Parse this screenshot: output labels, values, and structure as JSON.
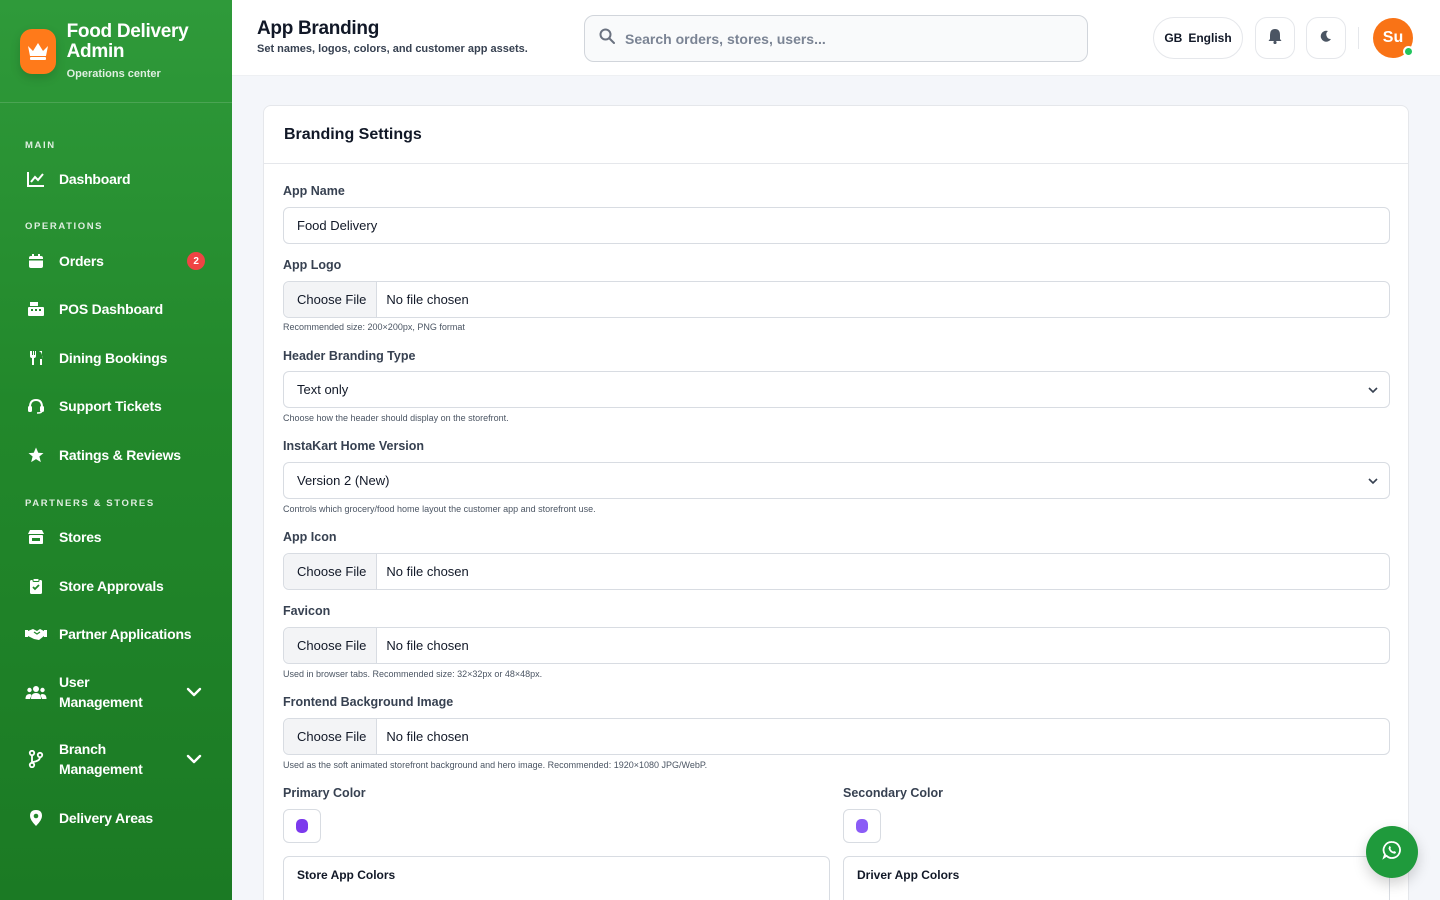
{
  "brand": {
    "title": "Food Delivery Admin",
    "subtitle": "Operations center",
    "logo_icon": "crown-icon"
  },
  "sidebar": {
    "sections": {
      "main": "MAIN",
      "operations": "OPERATIONS",
      "partners": "PARTNERS & STORES"
    },
    "items": [
      {
        "label": "Dashboard",
        "icon": "chart-line-icon"
      },
      {
        "label": "Orders",
        "icon": "calendar-icon",
        "badge": "2"
      },
      {
        "label": "POS Dashboard",
        "icon": "cash-register-icon"
      },
      {
        "label": "Dining Bookings",
        "icon": "utensils-icon"
      },
      {
        "label": "Support Tickets",
        "icon": "headset-icon"
      },
      {
        "label": "Ratings & Reviews",
        "icon": "star-icon"
      },
      {
        "label": "Stores",
        "icon": "store-icon"
      },
      {
        "label": "Store Approvals",
        "icon": "clipboard-check-icon"
      },
      {
        "label": "Partner Applications",
        "icon": "handshake-icon"
      },
      {
        "label_line1": "User",
        "label_line2": "Management",
        "icon": "users-icon"
      },
      {
        "label_line1": "Branch",
        "label_line2": "Management",
        "icon": "branch-icon"
      },
      {
        "label": "Delivery Areas",
        "icon": "map-pin-icon"
      }
    ]
  },
  "header": {
    "title": "App Branding",
    "subtitle": "Set names, logos, colors, and customer app assets.",
    "search_placeholder": "Search orders, stores, users...",
    "language_code": "GB",
    "language": "English",
    "avatar_initials": "Su"
  },
  "form": {
    "card_title": "Branding Settings",
    "app_name_label": "App Name",
    "app_name_value": "Food Delivery",
    "app_logo_label": "App Logo",
    "choose_file": "Choose File",
    "no_file": "No file chosen",
    "app_logo_help": "Recommended size: 200×200px, PNG format",
    "header_type_label": "Header Branding Type",
    "header_type_value": "Text only",
    "header_type_help": "Choose how the header should display on the storefront.",
    "home_version_label": "InstaKart Home Version",
    "home_version_value": "Version 2 (New)",
    "home_version_help": "Controls which grocery/food home layout the customer app and storefront use.",
    "app_icon_label": "App Icon",
    "favicon_label": "Favicon",
    "favicon_help": "Used in browser tabs. Recommended size: 32×32px or 48×48px.",
    "bg_image_label": "Frontend Background Image",
    "bg_image_help": "Used as the soft animated storefront background and hero image. Recommended: 1920×1080 JPG/WebP.",
    "primary_color_label": "Primary Color",
    "primary_color": "#7c3aed",
    "secondary_color_label": "Secondary Color",
    "secondary_color": "#8b5cf6",
    "store_app_colors": "Store App Colors",
    "driver_app_colors": "Driver App Colors"
  },
  "colors": {
    "sidebar": "#22882b",
    "accent": "#ff7a1a",
    "badge": "#ef4444",
    "fab": "#1f9a3c"
  }
}
